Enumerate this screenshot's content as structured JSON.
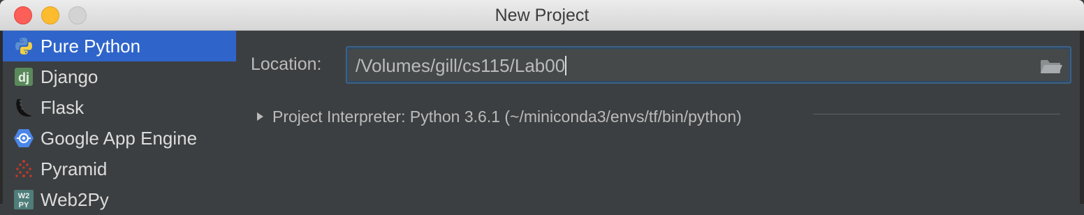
{
  "window": {
    "title": "New Project"
  },
  "sidebar": {
    "items": [
      {
        "label": "Pure Python",
        "icon": "python-icon",
        "selected": true
      },
      {
        "label": "Django",
        "icon": "django-icon",
        "selected": false
      },
      {
        "label": "Flask",
        "icon": "flask-icon",
        "selected": false
      },
      {
        "label": "Google App Engine",
        "icon": "google-app-engine-icon",
        "selected": false
      },
      {
        "label": "Pyramid",
        "icon": "pyramid-icon",
        "selected": false
      },
      {
        "label": "Web2Py",
        "icon": "web2py-icon",
        "selected": false
      }
    ]
  },
  "location": {
    "label": "Location:",
    "value": "/Volumes/gill/cs115/Lab00"
  },
  "interpreter": {
    "label": "Project Interpreter: Python 3.6.1 (~/miniconda3/envs/tf/bin/python)"
  },
  "colors": {
    "selection": "#2f65ca",
    "background": "#3c3f41",
    "text": "#bbbbbb",
    "focus_border": "#3d6185"
  }
}
